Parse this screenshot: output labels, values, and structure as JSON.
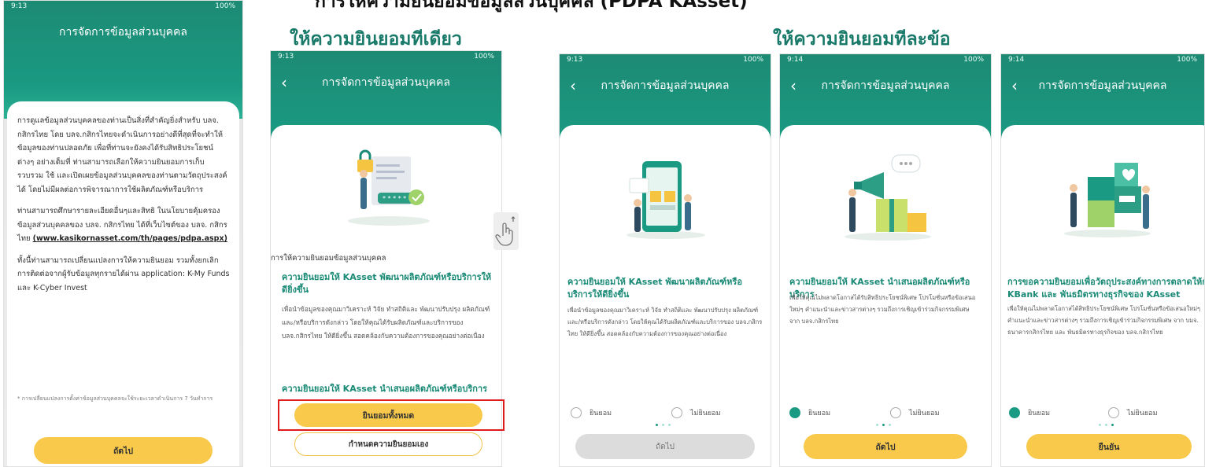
{
  "page_title": "การให้ความยินยอมข้อมูลส่วนบุคคล (PDPA KAsset)",
  "sections": {
    "left": "ให้ความยินยอมทีเดียว",
    "right": "ให้ความยินยอมทีละข้อ"
  },
  "colors": {
    "teal": "#1a9a82",
    "yellow": "#f8c94a",
    "highlight": "#e01b1b"
  },
  "screens": [
    {
      "time": "9:13",
      "battery": "100%",
      "header": "การจัดการข้อมูลส่วนบุคคล",
      "paragraphs": [
        "การดูแลข้อมูลส่วนบุคคลของท่านเป็นสิ่งที่สำคัญยิ่งสำหรับ บลจ. กสิกรไทย โดย บลจ.กสิกรไทยจะดำเนินการอย่างดีที่สุดที่จะทำให้ข้อมูลของท่านปลอดภัย เพื่อที่ท่านจะยังคงได้รับสิทธิประโยชน์ต่างๆ อย่างเต็มที่ ท่านสามารถเลือกให้ความยินยอมการเก็บ รวบรวม ใช้ และเปิดเผยข้อมูลส่วนบุคคลของท่านตามวัตถุประสงค์ได้ โดยไม่มีผลต่อการพิจารณาการใช้ผลิตภัณฑ์หรือบริการ",
        "ท่านสามารถศึกษารายละเอียดอื่นๆและสิทธิ ในนโยบายคุ้มครองข้อมูลส่วนบุคคลของ บลจ. กสิกรไทย ได้ที่เว็บไซต์ของ บลจ. กสิกรไทย",
        "ทั้งนี้ท่านสามารถเปลี่ยนแปลงการให้ความยินยอม รวมทั้งยกเลิกการติดต่อจากผู้รับข้อมูลทุกรายได้ผ่าน application: K-My Funds และ K-Cyber Invest"
      ],
      "link": "(www.kasikornasset.com/th/pages/pdpa.aspx)",
      "footnote": "* การเปลี่ยนแปลงการตั้งค่าข้อมูลส่วนบุคคลจะใช้ระยะเวลาดำเนินการ 7 วันทำการ",
      "button": "ถัดไป"
    },
    {
      "time": "9:13",
      "battery": "100%",
      "header": "การจัดการข้อมูลส่วนบุคคล",
      "section_label": "การให้ความยินยอมข้อมูลส่วนบุคคล",
      "heading1": "ความยินยอมให้ KAsset พัฒนาผลิตภัณฑ์หรือบริการให้ดียิ่งขึ้น",
      "desc1": "เพื่อนำข้อมูลของคุณมาวิเคราะห์ วิจัย ทำสถิติและ พัฒนาปรับปรุง ผลิตภัณฑ์และ/หรือบริการดังกล่าว โดยให้คุณได้รับผลิตภัณฑ์และบริการของ บลจ.กสิกรไทย ให้ดียิ่งขึ้น สอดคล้องกับความต้องการของคุณอย่างต่อเนื่อง",
      "heading2": "ความยินยอมให้ KAsset นำเสนอผลิตภัณฑ์หรือบริการ",
      "button_all": "ยินยอมทั้งหมด",
      "button_custom": "กำหนดความยินยอมเอง"
    },
    {
      "time": "9:13",
      "battery": "100%",
      "header": "การจัดการข้อมูลส่วนบุคคล",
      "heading": "ความยินยอมให้ KAsset พัฒนาผลิตภัณฑ์หรือบริการให้ดียิ่งขึ้น",
      "desc": "เพื่อนำข้อมูลของคุณมาวิเคราะห์ วิจัย ทำสถิติและ พัฒนาปรับปรุง ผลิตภัณฑ์และ/หรือบริการดังกล่าว โดยให้คุณได้รับผลิตภัณฑ์และบริการของ บลจ.กสิกรไทย ให้ดียิ่งขึ้น สอดคล้องกับความต้องการของคุณอย่างต่อเนื่อง",
      "consent": "ยินยอม",
      "decline": "ไม่ยินยอม",
      "button": "ถัดไป"
    },
    {
      "time": "9:14",
      "battery": "100%",
      "header": "การจัดการข้อมูลส่วนบุคคล",
      "heading": "ความยินยอมให้ KAsset นำเสนอผลิตภัณฑ์หรือบริการ",
      "desc": "เพื่อให้คุณไม่พลาดโอกาสได้รับสิทธิประโยชน์พิเศษ โปรโมชั่นหรือข้อเสนอใหม่ๆ คำแนะนำและข่าวสารต่างๆ รวมถึงการเชิญเข้าร่วมกิจกรรมพิเศษ จาก บลจ.กสิกรไทย",
      "consent": "ยินยอม",
      "decline": "ไม่ยินยอม",
      "button": "ถัดไป"
    },
    {
      "time": "9:14",
      "battery": "100%",
      "header": "การจัดการข้อมูลส่วนบุคคล",
      "heading": "การขอความยินยอมเพื่อวัตถุประสงค์ทางการตลาดให้กับ KBank และ พันธมิตรทางธุรกิจของ KAsset",
      "desc": "เพื่อให้คุณไม่พลาดโอกาสได้สิทธิประโยชน์พิเศษ โปรโมชั่นหรือข้อเสนอใหม่ๆ คำแนะนำและข่าวสารต่างๆ รวมถึงการเชิญเข้าร่วมกิจกรรมพิเศษ จาก บมจ. ธนาคารกสิกรไทย และ พันธมิตรทางธุรกิจของ บลจ.กสิกรไทย",
      "consent": "ยินยอม",
      "decline": "ไม่ยินยอม",
      "button": "ยืนยัน"
    }
  ]
}
